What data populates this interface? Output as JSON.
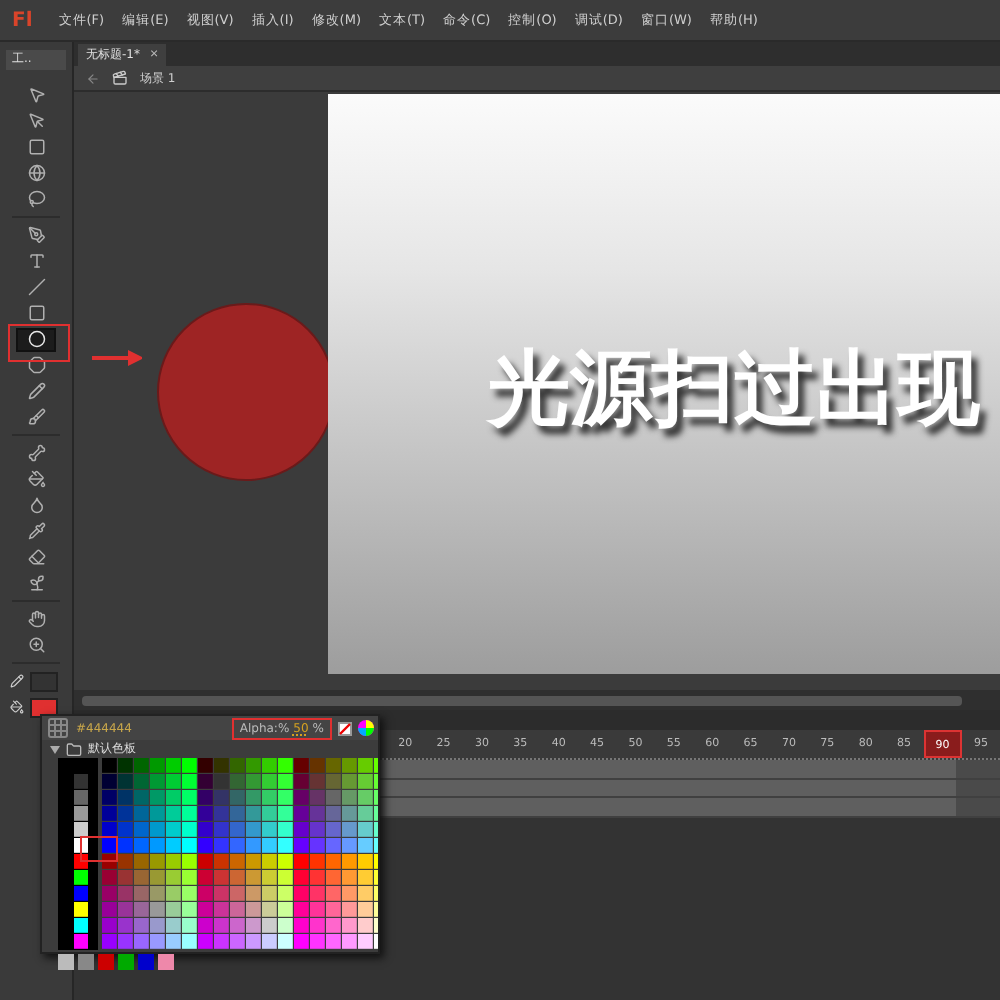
{
  "app": {
    "logo": "Fl"
  },
  "menu": [
    "文件(F)",
    "编辑(E)",
    "视图(V)",
    "插入(I)",
    "修改(M)",
    "文本(T)",
    "命令(C)",
    "控制(O)",
    "调试(D)",
    "窗口(W)",
    "帮助(H)"
  ],
  "toolbar": {
    "title": "工..",
    "tool_groups": [
      [
        {
          "kind": "select",
          "selected": false
        },
        {
          "kind": "subselect",
          "selected": false
        },
        {
          "kind": "gradient",
          "selected": false
        },
        {
          "kind": "rotate3d",
          "selected": false
        },
        {
          "kind": "lasso",
          "selected": false
        }
      ],
      [
        {
          "kind": "pen",
          "selected": false
        },
        {
          "kind": "text",
          "selected": false
        },
        {
          "kind": "line",
          "selected": false
        },
        {
          "kind": "rect",
          "selected": false
        },
        {
          "kind": "oval",
          "selected": true
        },
        {
          "kind": "polystar",
          "selected": false
        },
        {
          "kind": "pencil",
          "selected": false
        },
        {
          "kind": "brush",
          "selected": false
        }
      ],
      [
        {
          "kind": "bone",
          "selected": false
        },
        {
          "kind": "bucket",
          "selected": false
        },
        {
          "kind": "ink",
          "selected": false
        },
        {
          "kind": "dropper",
          "selected": false
        },
        {
          "kind": "eraser",
          "selected": false
        },
        {
          "kind": "deco",
          "selected": false
        }
      ],
      [
        {
          "kind": "hand",
          "selected": false
        },
        {
          "kind": "zoom",
          "selected": false
        }
      ]
    ]
  },
  "document_tab": {
    "title": "无标题-1*",
    "close": "×"
  },
  "breadcrumb": {
    "scene": "场景 1"
  },
  "stage": {
    "text": "光源扫过出现"
  },
  "timeline": {
    "ruler": [
      {
        "label": "20",
        "selected": false
      },
      {
        "label": "25",
        "selected": false
      },
      {
        "label": "30",
        "selected": false
      },
      {
        "label": "35",
        "selected": false
      },
      {
        "label": "40",
        "selected": false
      },
      {
        "label": "45",
        "selected": false
      },
      {
        "label": "50",
        "selected": false
      },
      {
        "label": "55",
        "selected": false
      },
      {
        "label": "60",
        "selected": false
      },
      {
        "label": "65",
        "selected": false
      },
      {
        "label": "70",
        "selected": false
      },
      {
        "label": "75",
        "selected": false
      },
      {
        "label": "80",
        "selected": false
      },
      {
        "label": "85",
        "selected": false
      },
      {
        "label": "90",
        "selected": true
      },
      {
        "label": "95",
        "selected": false
      }
    ]
  },
  "color_picker": {
    "hex": "#444444",
    "alpha_label": "Alpha:%",
    "alpha_value": "50",
    "alpha_unit": "%",
    "swatch_set": "默认色板"
  }
}
